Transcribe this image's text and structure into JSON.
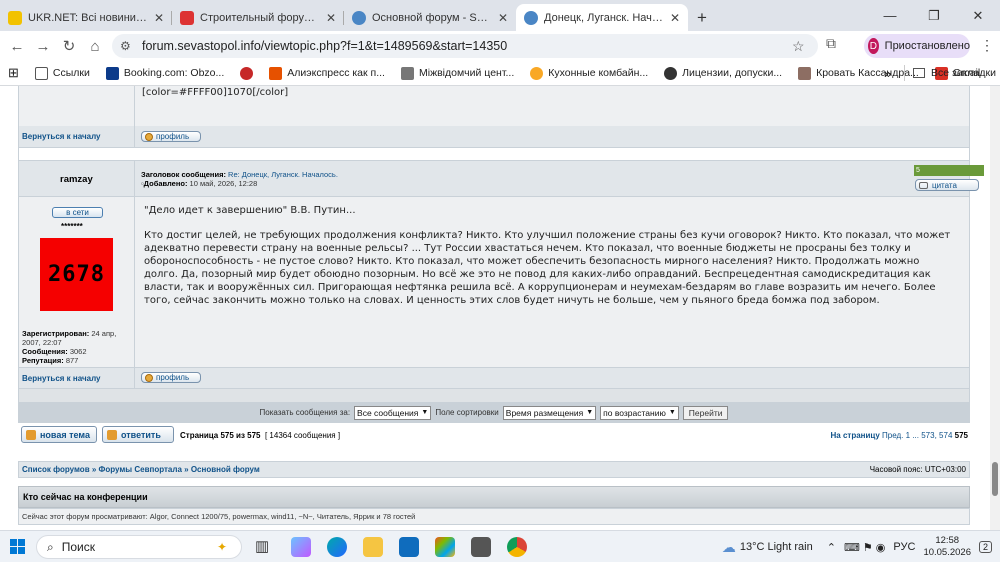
{
  "browser": {
    "tabs": [
      {
        "title": "UKR.NET: Всі новини України, ",
        "color": "#f2c200"
      },
      {
        "title": "Строительный форум Украи",
        "color": "#d33"
      },
      {
        "title": "Основной форум - Sevastopol",
        "color": "#4a86c5"
      },
      {
        "title": "Донецк, Луганск. Началось. - ",
        "color": "#4a86c5"
      }
    ],
    "window_controls": [
      "—",
      "❐",
      "✕"
    ],
    "url": "forum.sevastopol.info/viewtopic.php?f=1&t=1489569&start=14350",
    "profile_initial": "D",
    "profile_label": "Приостановлено",
    "bookmarks": [
      {
        "label": "Ссылки",
        "color": "#ffffff"
      },
      {
        "label": "Booking.com: Obzo...",
        "color": "#0c3b8a"
      },
      {
        "label": "",
        "color": "#c62828"
      },
      {
        "label": "Алиэкспресс как п...",
        "color": "#e65100"
      },
      {
        "label": "Міжвідомчий цент...",
        "color": "#777777"
      },
      {
        "label": "Кухонные комбайн...",
        "color": "#f9a825"
      },
      {
        "label": "Лицензии, допуски...",
        "color": "#333333"
      },
      {
        "label": "Кровать Кассандра...",
        "color": "#8d6e63"
      },
      {
        "label": "Gmail",
        "color": "#d93025"
      }
    ],
    "all_bookmarks": "Все закладки"
  },
  "forum": {
    "prev_post_tail": "[color=#FFFF00]1070[/color]",
    "back_to_top": "Вернуться к началу",
    "profile_btn": "профиль",
    "post": {
      "author": "ramzay",
      "subject_label": "Заголовок сообщения:",
      "subject": "Re: Донецк, Луганск. Началось.",
      "added_label": "Добавлено:",
      "added": "10 май, 2026, 12:28",
      "rep_mark": "5",
      "quote_btn": "цитата",
      "online": "в сети",
      "stars": "*******",
      "avatar_text": "2678",
      "registered_label": "Зарегистрирован:",
      "registered": "24 апр, 2007, 22:07",
      "posts_label": "Сообщения:",
      "posts": "3062",
      "rep_label": "Репутация:",
      "rep": "877",
      "quote_line": "\"Дело идет к завершению\" В.В. Путин...",
      "body": "Кто достиг целей, не требующих продолжения конфликта? Никто. Кто улучшил положение страны без кучи оговорок? Никто. Кто показал, что может адекватно перевести страну на военные рельсы? ... Тут России хвастаться нечем. Кто показал, что военные бюджеты не просраны без толку и обороноспособность - не пустое слово? Никто. Кто показал, что может обеспечить безопасность мирного населения? Никто. Продолжать можно долго. Да, позорный мир будет обоюдно позорным. Но всё же это не повод для каких-либо оправданий. Беспрецедентная самодискредитация как власти, так и вооружённых сил. Пригорающая нефтянка решила всё. А коррупционерам и неумехам-бездарям во главе возразить им нечего. Более того, сейчас закончить можно только на словах. И ценность этих слов будет ничуть не больше, чем у пьяного бреда бомжа под забором."
    },
    "sort": {
      "show_label": "Показать сообщения за:",
      "show_value": "Все сообщения",
      "sort_label": "Поле сортировки",
      "sort_value": "Время размещения",
      "dir_value": "по возрастанию",
      "go": "Перейти"
    },
    "actions": {
      "new_topic": "новая тема",
      "reply": "ответить",
      "page_info": "Страница 575 из 575",
      "count_info": "[ 14364 сообщения ]",
      "goto_label": "На страницу",
      "prev": "Пред.",
      "p1": "1",
      "dots": "...",
      "p573": "573",
      "p574": "574",
      "p575": "575"
    },
    "breadcrumbs": {
      "a": "Список форумов",
      "sep": "»",
      "b": "Форумы Севпортала",
      "c": "Основной форум",
      "tz": "Часовой пояс: UTC+03:00"
    },
    "whoisonline": {
      "title": "Кто сейчас на конференции",
      "text": "Сейчас этот форум просматривают: Algor, Connect 1200/75, powermax, wind11, ~N~, Читатель, Яррик и 78 гостей"
    }
  },
  "taskbar": {
    "search": "Поиск",
    "weather": "13°C  Light rain",
    "lang": "РУС",
    "time": "12:58",
    "date": "10.05.2026",
    "notif": "2"
  }
}
